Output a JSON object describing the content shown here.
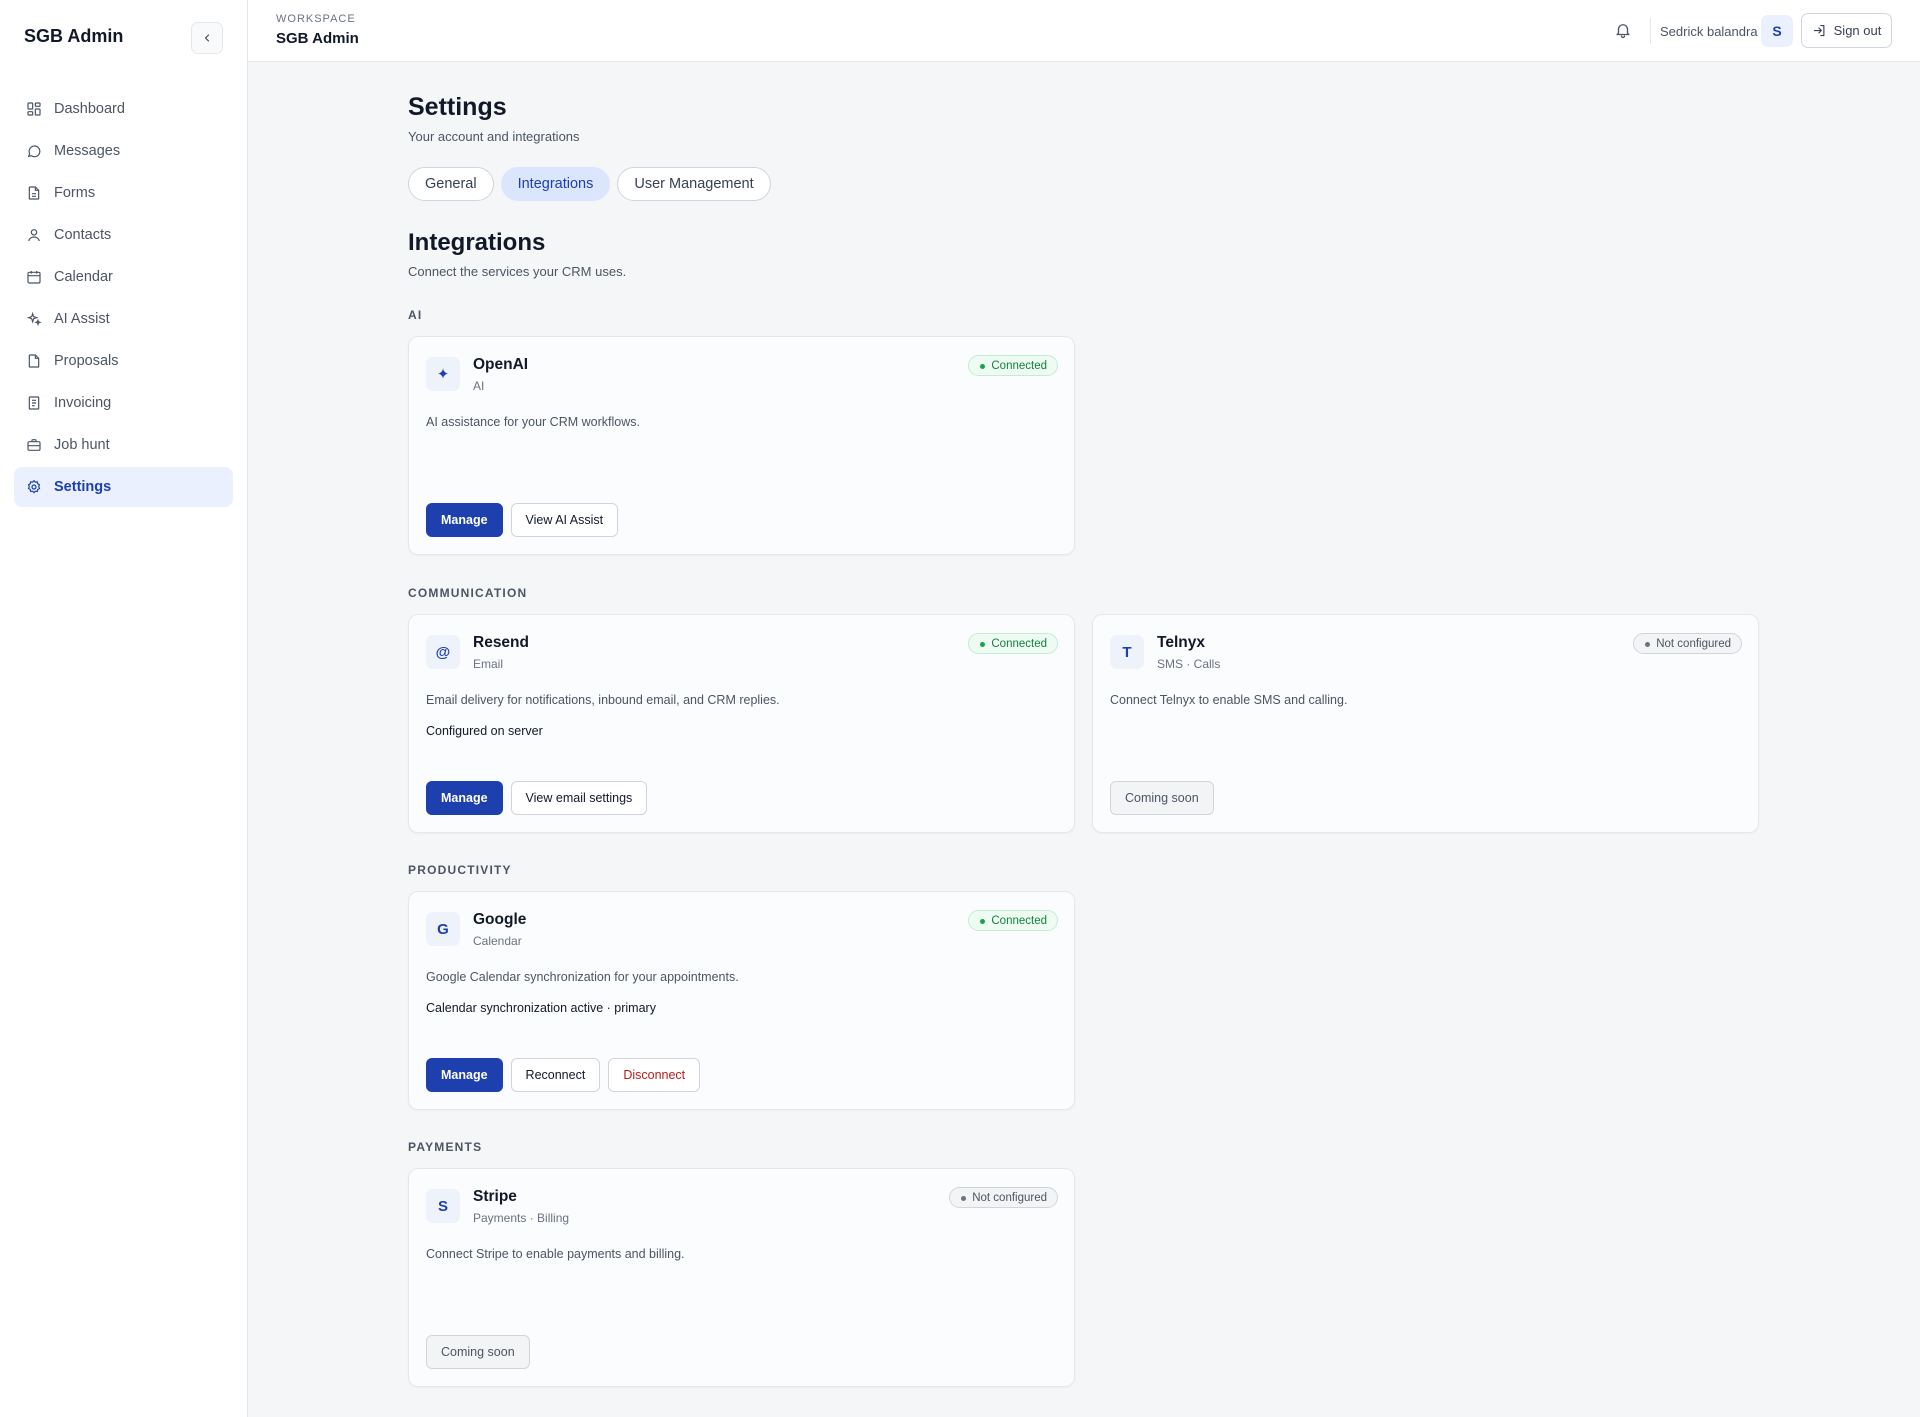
{
  "sidebar": {
    "brand": "SGB Admin",
    "items": [
      {
        "label": "Dashboard",
        "icon": "dashboard-icon",
        "active": false
      },
      {
        "label": "Messages",
        "icon": "message-icon",
        "active": false
      },
      {
        "label": "Forms",
        "icon": "document-icon",
        "active": false
      },
      {
        "label": "Contacts",
        "icon": "user-icon",
        "active": false
      },
      {
        "label": "Calendar",
        "icon": "calendar-icon",
        "active": false
      },
      {
        "label": "AI Assist",
        "icon": "sparkles-icon",
        "active": false
      },
      {
        "label": "Proposals",
        "icon": "file-icon",
        "active": false
      },
      {
        "label": "Invoicing",
        "icon": "receipt-icon",
        "active": false
      },
      {
        "label": "Job hunt",
        "icon": "briefcase-icon",
        "active": false
      },
      {
        "label": "Settings",
        "icon": "gear-icon",
        "active": true
      }
    ]
  },
  "topbar": {
    "workspace_label": "WORKSPACE",
    "workspace_name": "SGB Admin",
    "user_name": "Sedrick balandra",
    "avatar_initial": "S",
    "signout_label": "Sign out"
  },
  "page": {
    "title": "Settings",
    "subtitle": "Your account and integrations",
    "tabs": [
      {
        "label": "General",
        "active": false
      },
      {
        "label": "Integrations",
        "active": true
      },
      {
        "label": "User Management",
        "active": false
      }
    ]
  },
  "integrations": {
    "title": "Integrations",
    "subtitle": "Connect the services your CRM uses.",
    "categories": {
      "ai": "AI",
      "communication": "COMMUNICATION",
      "productivity": "PRODUCTIVITY",
      "payments": "PAYMENTS"
    },
    "cards": {
      "openai": {
        "icon": "✦",
        "name": "OpenAI",
        "type": "AI",
        "badge": "Connected",
        "description": "AI assistance for your CRM workflows.",
        "actions": [
          "Manage",
          "View AI Assist"
        ]
      },
      "resend": {
        "icon": "@",
        "name": "Resend",
        "type": "Email",
        "badge": "Connected",
        "description": "Email delivery for notifications, inbound email, and CRM replies.",
        "status": "Configured on server",
        "actions": [
          "Manage",
          "View email settings"
        ]
      },
      "telnyx": {
        "icon": "T",
        "name": "Telnyx",
        "type": "SMS · Calls",
        "badge": "Not configured",
        "description": "Connect Telnyx to enable SMS and calling.",
        "actions": [
          "Coming soon"
        ]
      },
      "google": {
        "icon": "G",
        "name": "Google",
        "type": "Calendar",
        "badge": "Connected",
        "description": "Google Calendar synchronization for your appointments.",
        "status": "Calendar synchronization active · primary",
        "actions": [
          "Manage",
          "Reconnect",
          "Disconnect"
        ]
      },
      "stripe": {
        "icon": "S",
        "name": "Stripe",
        "type": "Payments · Billing",
        "badge": "Not configured",
        "description": "Connect Stripe to enable payments and billing.",
        "actions": [
          "Coming soon"
        ]
      }
    }
  },
  "colors": {
    "accent": "#1e40af",
    "active_bg": "#eaf0fd",
    "connected": "#15803d",
    "danger": "#b91c1c"
  }
}
